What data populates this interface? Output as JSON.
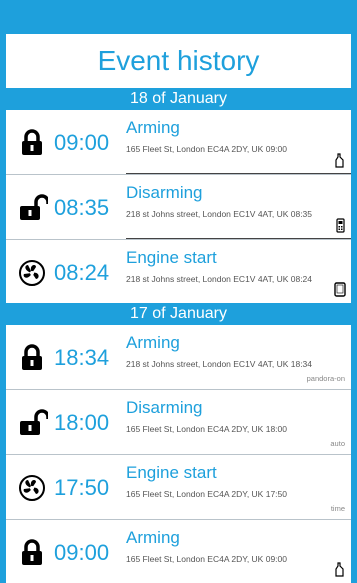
{
  "title": "Event history",
  "colors": {
    "accent": "#1ea0dc"
  },
  "groups": [
    {
      "date": "18 of January",
      "events": [
        {
          "icon": "lock-closed-icon",
          "time": "09:00",
          "title": "Arming",
          "address": "165 Fleet St, London EC4A 2DY, UK 09:00",
          "source": "phone-icon",
          "tag": ""
        },
        {
          "icon": "lock-open-icon",
          "time": "08:35",
          "title": "Disarming",
          "address": "218 st Johns street, London EC1V 4AT, UK 08:35",
          "source": "keyfob-icon",
          "tag": ""
        },
        {
          "icon": "engine-icon",
          "time": "08:24",
          "title": "Engine start",
          "address": "218 st Johns street, London EC1V 4AT, UK 08:24",
          "source": "smartphone-icon",
          "tag": ""
        }
      ]
    },
    {
      "date": "17 of January",
      "events": [
        {
          "icon": "lock-closed-icon",
          "time": "18:34",
          "title": "Arming",
          "address": "218 st Johns street, London EC1V 4AT, UK 18:34",
          "source": "",
          "tag": "pandora-on"
        },
        {
          "icon": "lock-open-icon",
          "time": "18:00",
          "title": "Disarming",
          "address": "165 Fleet St, London EC4A 2DY, UK 18:00",
          "source": "",
          "tag": "auto"
        },
        {
          "icon": "engine-icon",
          "time": "17:50",
          "title": "Engine start",
          "address": "165 Fleet St, London EC4A 2DY, UK 17:50",
          "source": "",
          "tag": "time"
        },
        {
          "icon": "lock-closed-icon",
          "time": "09:00",
          "title": "Arming",
          "address": "165 Fleet St, London EC4A 2DY, UK 09:00",
          "source": "phone-icon",
          "tag": ""
        }
      ]
    }
  ]
}
